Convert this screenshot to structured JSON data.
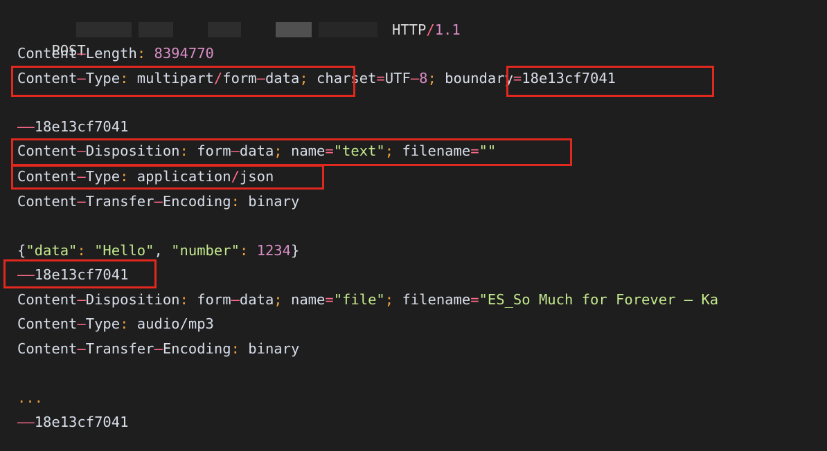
{
  "request": {
    "method": "POST",
    "protocol_http": "HTTP",
    "protocol_slash": "/",
    "protocol_ver": "1.1",
    "content_length": {
      "key": "Content",
      "dash": "–",
      "key2": "Length",
      "colon": ":",
      "value": " 8394770"
    },
    "content_type": {
      "key": "Content",
      "dash": "–",
      "key2": "Type",
      "colon": ":",
      "v1": " multipart",
      "slash": "/",
      "v2": "form",
      "dash2": "–",
      "v3": "data",
      "semi": ";",
      "charset_key": " charset",
      "eq": "=",
      "charset_a": "UTF",
      "charset_dash": "–",
      "charset_b": "8",
      "semi2": ";",
      "boundary_key": " boundary",
      "eq2": "=",
      "boundary_val": "18e13cf7041"
    }
  },
  "part1": {
    "boundary": "18e13cf7041",
    "disposition": {
      "key": "Content",
      "dash": "–",
      "key2": "Disposition",
      "colon": ":",
      "v1": " form",
      "dash2": "–",
      "v2": "data",
      "semi": ";",
      "name_key": " name",
      "eq": "=",
      "name_val": "\"text\"",
      "semi2": ";",
      "filename_key": " filename",
      "eq2": "=",
      "filename_val": "\"\""
    },
    "type": {
      "key": "Content",
      "dash": "–",
      "key2": "Type",
      "colon": ":",
      "v1": " application",
      "slash": "/",
      "v2": "json"
    },
    "encoding": {
      "key": "Content",
      "dash": "–",
      "key2": "Transfer",
      "dash2": "–",
      "key3": "Encoding",
      "colon": ":",
      "value": " binary"
    },
    "body": {
      "brace_open": "{",
      "k1": "\"data\"",
      "c1": ":",
      "v1": " \"Hello\"",
      "comma": ",",
      "k2": " \"number\"",
      "c2": ":",
      "v2": " 1234",
      "brace_close": "}"
    }
  },
  "part2": {
    "boundary": "18e13cf7041",
    "disposition": {
      "key": "Content",
      "dash": "–",
      "key2": "Disposition",
      "colon": ":",
      "v1": " form",
      "dash2": "–",
      "v2": "data",
      "semi": ";",
      "name_key": " name",
      "eq": "=",
      "name_val": "\"file\"",
      "semi2": ";",
      "filename_key": " filename",
      "eq2": "=",
      "filename_val": "\"ES_So Much for Forever – Ka"
    },
    "type": {
      "key": "Content",
      "dash": "–",
      "key2": "Type",
      "colon": ":",
      "value": " audio/mp3"
    },
    "encoding": {
      "key": "Content",
      "dash": "–",
      "key2": "Transfer",
      "dash2": "–",
      "key3": "Encoding",
      "colon": ":",
      "value": " binary"
    }
  },
  "ellipsis": "...",
  "final_boundary": "18e13cf7041",
  "boundary_prefix": "––",
  "colors": {
    "background": "#1e1e1e",
    "highlight_box": "#e0281f",
    "operator": "#ff6b8a",
    "colon": "#f0a33c",
    "string": "#c3e88d",
    "number": "#d98dc6"
  }
}
